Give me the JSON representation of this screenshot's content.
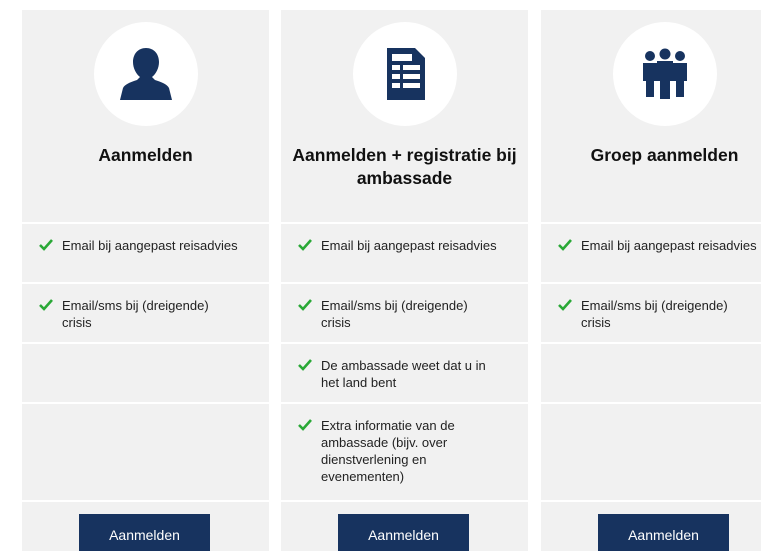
{
  "colors": {
    "accent": "#17335f",
    "check": "#2aa837",
    "card_bg": "#f1f1f1"
  },
  "cards": [
    {
      "title": "Aanmelden",
      "icon": "person-icon",
      "features": [
        "Email bij aangepast reisadvies",
        "Email/sms bij (dreigende) crisis"
      ],
      "button": "Aanmelden"
    },
    {
      "title": "Aanmelden + registratie bij ambassade",
      "icon": "document-icon",
      "features": [
        "Email bij aangepast reisadvies",
        "Email/sms bij (dreigende) crisis",
        "De ambassade weet dat u in het land bent",
        "Extra informatie van de ambassade (bijv. over dienstverlening en evenementen)"
      ],
      "button": "Aanmelden"
    },
    {
      "title": "Groep aanmelden",
      "icon": "group-icon",
      "features": [
        "Email bij aangepast reisadvies",
        "Email/sms bij (dreigende) crisis"
      ],
      "button": "Aanmelden"
    }
  ]
}
